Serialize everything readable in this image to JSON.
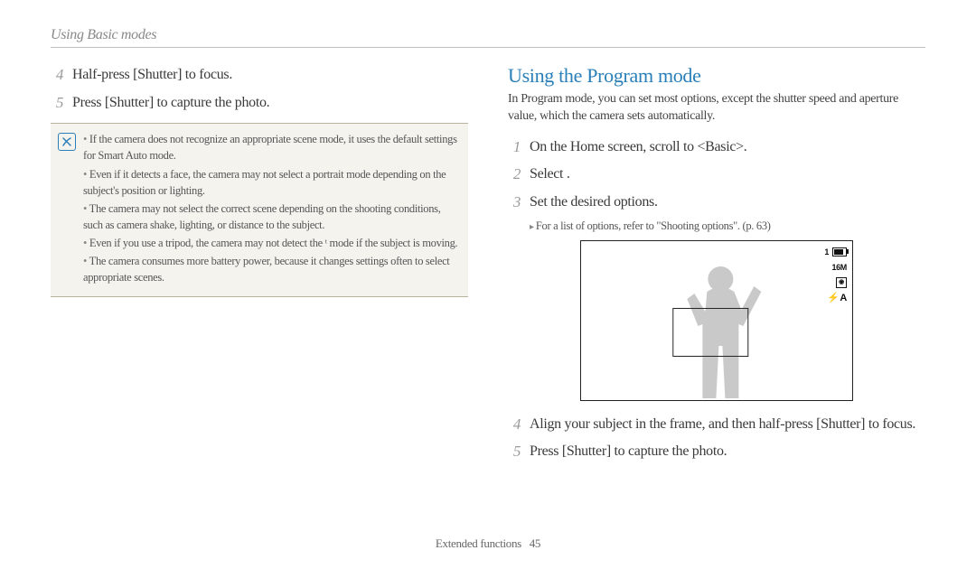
{
  "header": {
    "running_head": "Using Basic modes"
  },
  "left": {
    "steps": {
      "s4": {
        "num": "4",
        "text": "Half-press [Shutter] to focus."
      },
      "s5": {
        "num": "5",
        "text": "Press [Shutter] to capture the photo."
      }
    },
    "note_items": [
      "If the camera does not recognize an appropriate scene mode, it uses the default settings for Smart Auto mode.",
      "Even if it detects a face, the camera may not select a portrait mode depending on the subject's position or lighting.",
      "The camera may not select the correct scene depending on the shooting conditions, such as camera shake, lighting, or distance to the subject.",
      "Even if you use a tripod, the camera may not detect the  ᵗ  mode if the subject is moving.",
      "The camera consumes more battery power, because it changes settings often to select appropriate scenes."
    ]
  },
  "right": {
    "section_title": "Using the Program mode",
    "intro": "In Program mode, you can set most options, except the shutter speed and aperture value, which the camera sets automatically.",
    "steps": {
      "s1": {
        "num": "1",
        "text": "On the Home screen, scroll to <Basic>."
      },
      "s2": {
        "num": "2",
        "text": "Select       ."
      },
      "s3": {
        "num": "3",
        "text": "Set the desired options."
      },
      "s3_sub": "For a list of options, refer to \"Shooting options\". (p. 63)",
      "s4": {
        "num": "4",
        "text": "Align your subject in the frame, and then half-press [Shutter] to focus."
      },
      "s5": {
        "num": "5",
        "text": "Press [Shutter] to capture the photo."
      }
    },
    "osd": {
      "count": "1",
      "res": "16M",
      "flash": "A"
    }
  },
  "footer": {
    "section": "Extended functions",
    "page": "45"
  }
}
